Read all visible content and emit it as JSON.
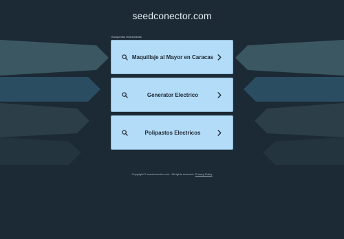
{
  "header": {
    "domain": "seedconector.com"
  },
  "related": {
    "label": "Búsquedas relacionadas",
    "items": [
      {
        "label": "Maquillaje al Mayor en Caracas"
      },
      {
        "label": "Generator Electrico"
      },
      {
        "label": "Polipastos Electricos"
      }
    ]
  },
  "footer": {
    "copyright": "Copyright © seedconector.com . All rights reserved.",
    "separator": " ",
    "privacy": "Privacy Policy"
  },
  "colors": {
    "background": "#1c2a35",
    "card": "#b3dcf8",
    "card_border": "#8fbad6",
    "card_text": "#1d2630"
  },
  "icons": {
    "left": "search-icon",
    "right": "chevron-right-icon"
  }
}
